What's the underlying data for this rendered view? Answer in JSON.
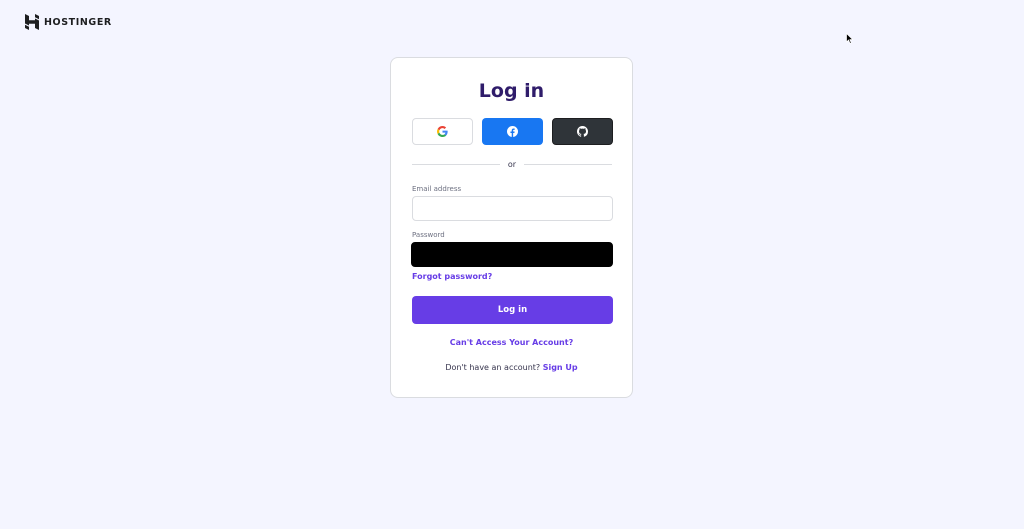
{
  "brand": {
    "name": "HOSTINGER",
    "color": "#1d1e20"
  },
  "login": {
    "title": "Log in",
    "divider_text": "or",
    "email_label": "Email address",
    "email_value": "",
    "password_label": "Password",
    "forgot_password": "Forgot password?",
    "submit_label": "Log in",
    "cant_access": "Can't Access Your Account?",
    "no_account_text": "Don't have an account?",
    "signup_link": "Sign Up"
  },
  "social": [
    {
      "name": "google",
      "icon": "google-icon"
    },
    {
      "name": "facebook",
      "icon": "facebook-icon",
      "color": "#1877f2"
    },
    {
      "name": "github",
      "icon": "github-icon",
      "color": "#2f3439"
    }
  ],
  "colors": {
    "accent": "#673de6",
    "title": "#2f1c6a",
    "background": "#f4f5ff"
  }
}
